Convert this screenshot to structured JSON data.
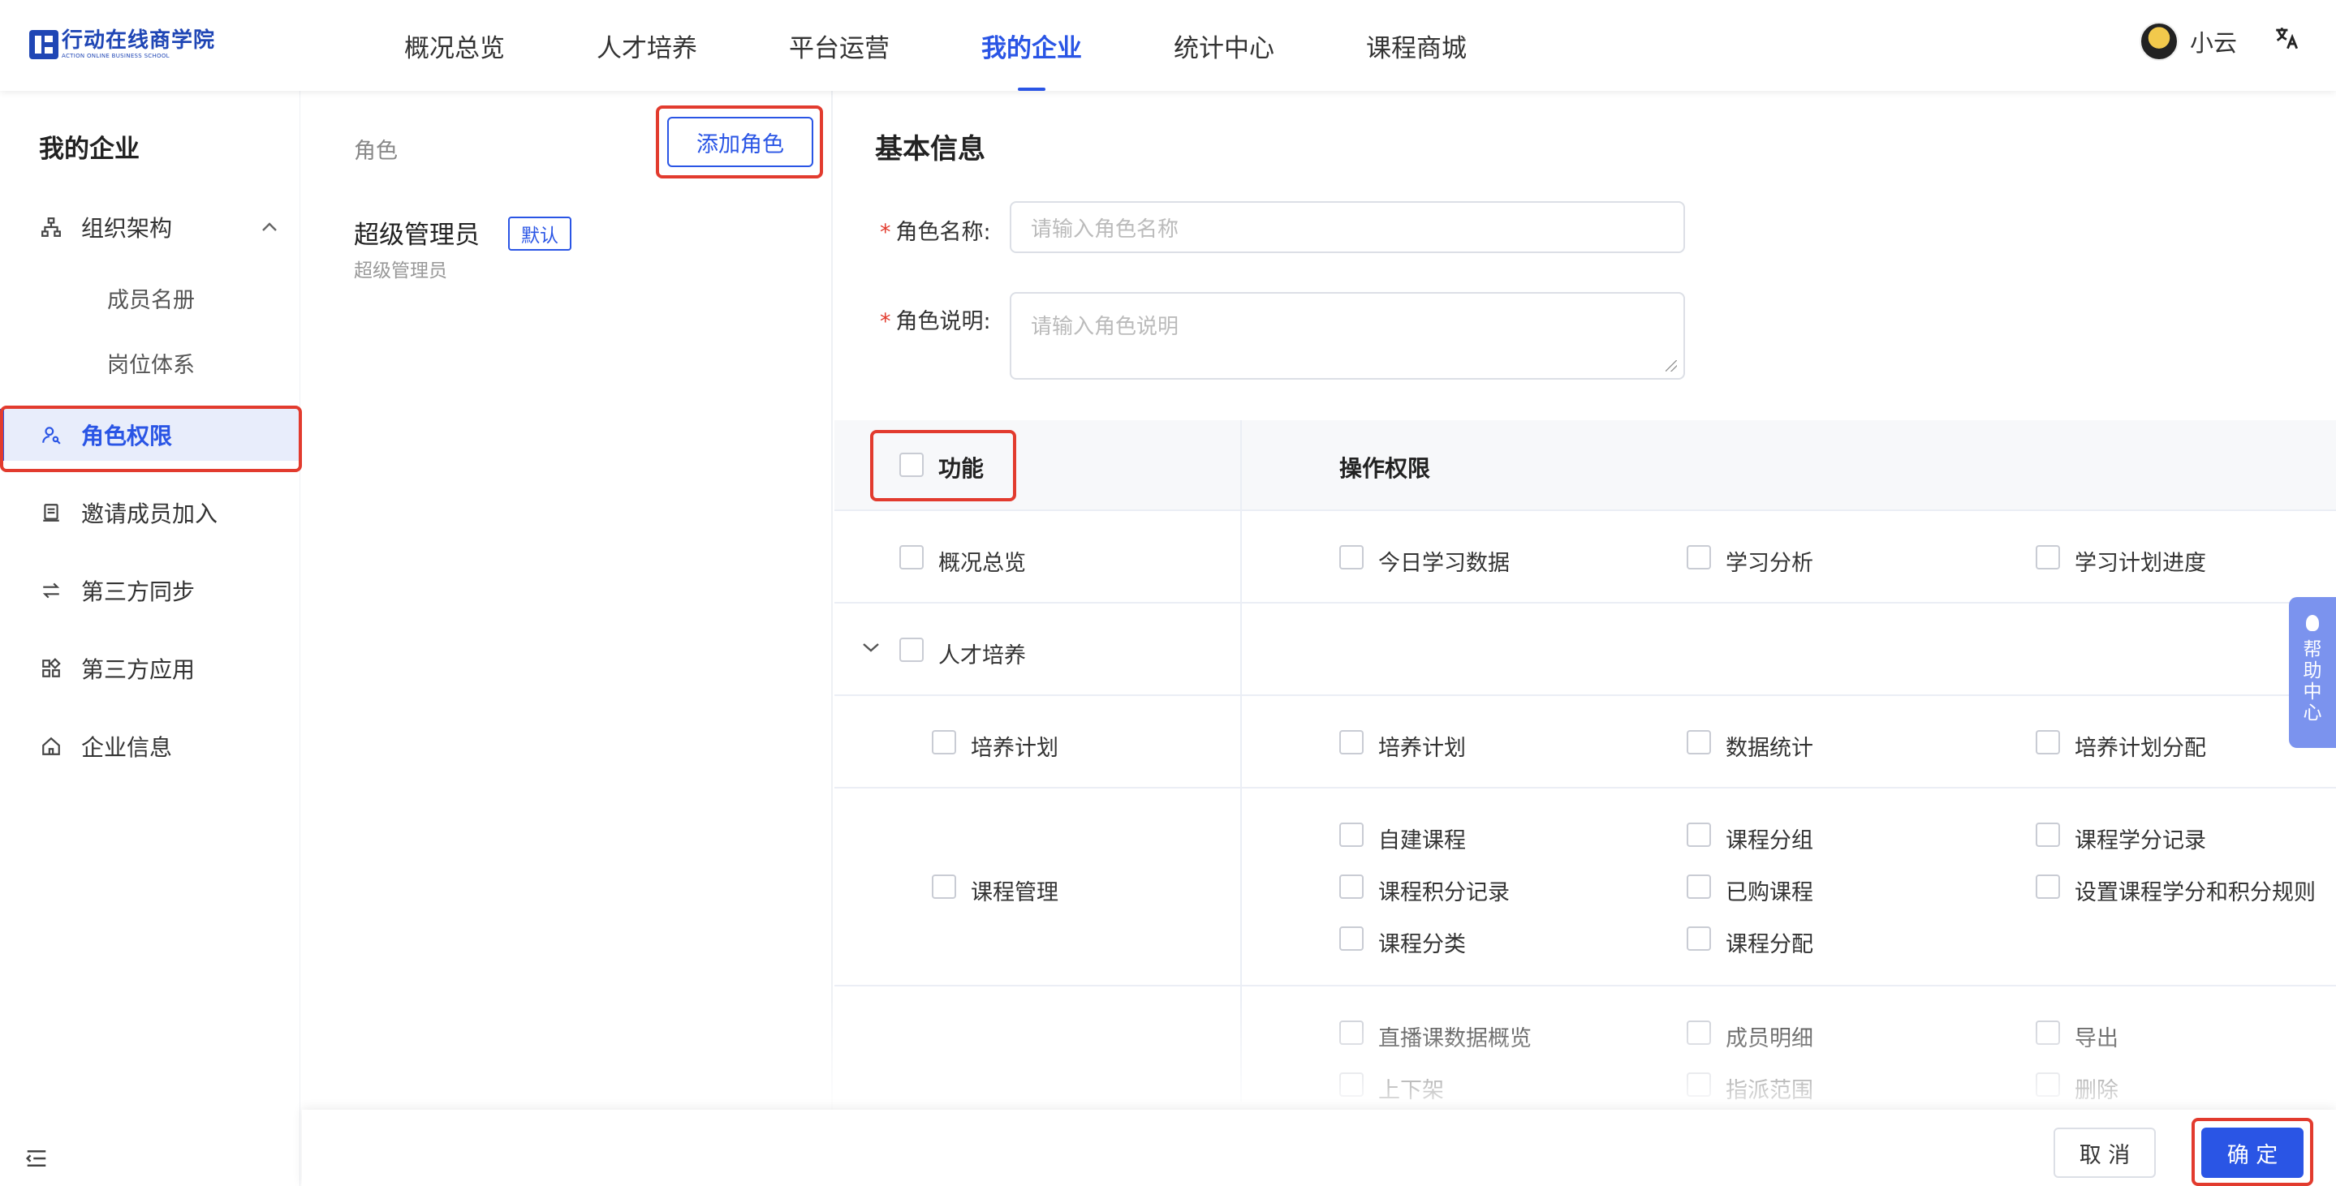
{
  "brand": {
    "name_cn": "行动在线商学院",
    "name_en": "ACTION ONLINE BUSINESS SCHOOL"
  },
  "nav": {
    "items": [
      "概况总览",
      "人才培养",
      "平台运营",
      "我的企业",
      "统计中心",
      "课程商城"
    ],
    "active": "我的企业"
  },
  "user": {
    "name": "小云",
    "lang_icon": "translate-icon"
  },
  "sidebar": {
    "title": "我的企业",
    "items": [
      {
        "label": "组织架构",
        "icon": "org-chart-icon",
        "expanded": true
      },
      {
        "label": "成员名册"
      },
      {
        "label": "岗位体系"
      },
      {
        "label": "角色权限",
        "icon": "user-key-icon",
        "active": true
      },
      {
        "label": "邀请成员加入",
        "icon": "document-icon"
      },
      {
        "label": "第三方同步",
        "icon": "swap-icon"
      },
      {
        "label": "第三方应用",
        "icon": "apps-icon"
      },
      {
        "label": "企业信息",
        "icon": "home-icon"
      }
    ]
  },
  "roles": {
    "header": "角色",
    "add_button": "添加角色",
    "list": [
      {
        "name": "超级管理员",
        "badge": "默认",
        "desc": "超级管理员"
      }
    ]
  },
  "form": {
    "section_title": "基本信息",
    "role_name_label": "角色名称:",
    "role_name_placeholder": "请输入角色名称",
    "role_desc_label": "角色说明:",
    "role_desc_placeholder": "请输入角色说明"
  },
  "permissions": {
    "col_function": "功能",
    "col_actions": "操作权限",
    "rows": [
      {
        "function": "概况总览",
        "actions": [
          "今日学习数据",
          "学习分析",
          "学习计划进度"
        ]
      },
      {
        "function": "人才培养",
        "group": true,
        "actions": []
      },
      {
        "function": "培养计划",
        "actions": [
          "培养计划",
          "数据统计",
          "培养计划分配"
        ]
      },
      {
        "function": "课程管理",
        "actions": [
          "自建课程",
          "课程分组",
          "课程学分记录",
          "课程积分记录",
          "已购课程",
          "设置课程学分和积分规则",
          "课程分类",
          "课程分配"
        ]
      },
      {
        "function": "",
        "actions": [
          "直播课数据概览",
          "成员明细",
          "导出",
          "上下架",
          "指派范围",
          "删除"
        ]
      }
    ]
  },
  "footer": {
    "cancel": "取 消",
    "ok": "确 定"
  },
  "help": {
    "label": "帮助中心"
  }
}
